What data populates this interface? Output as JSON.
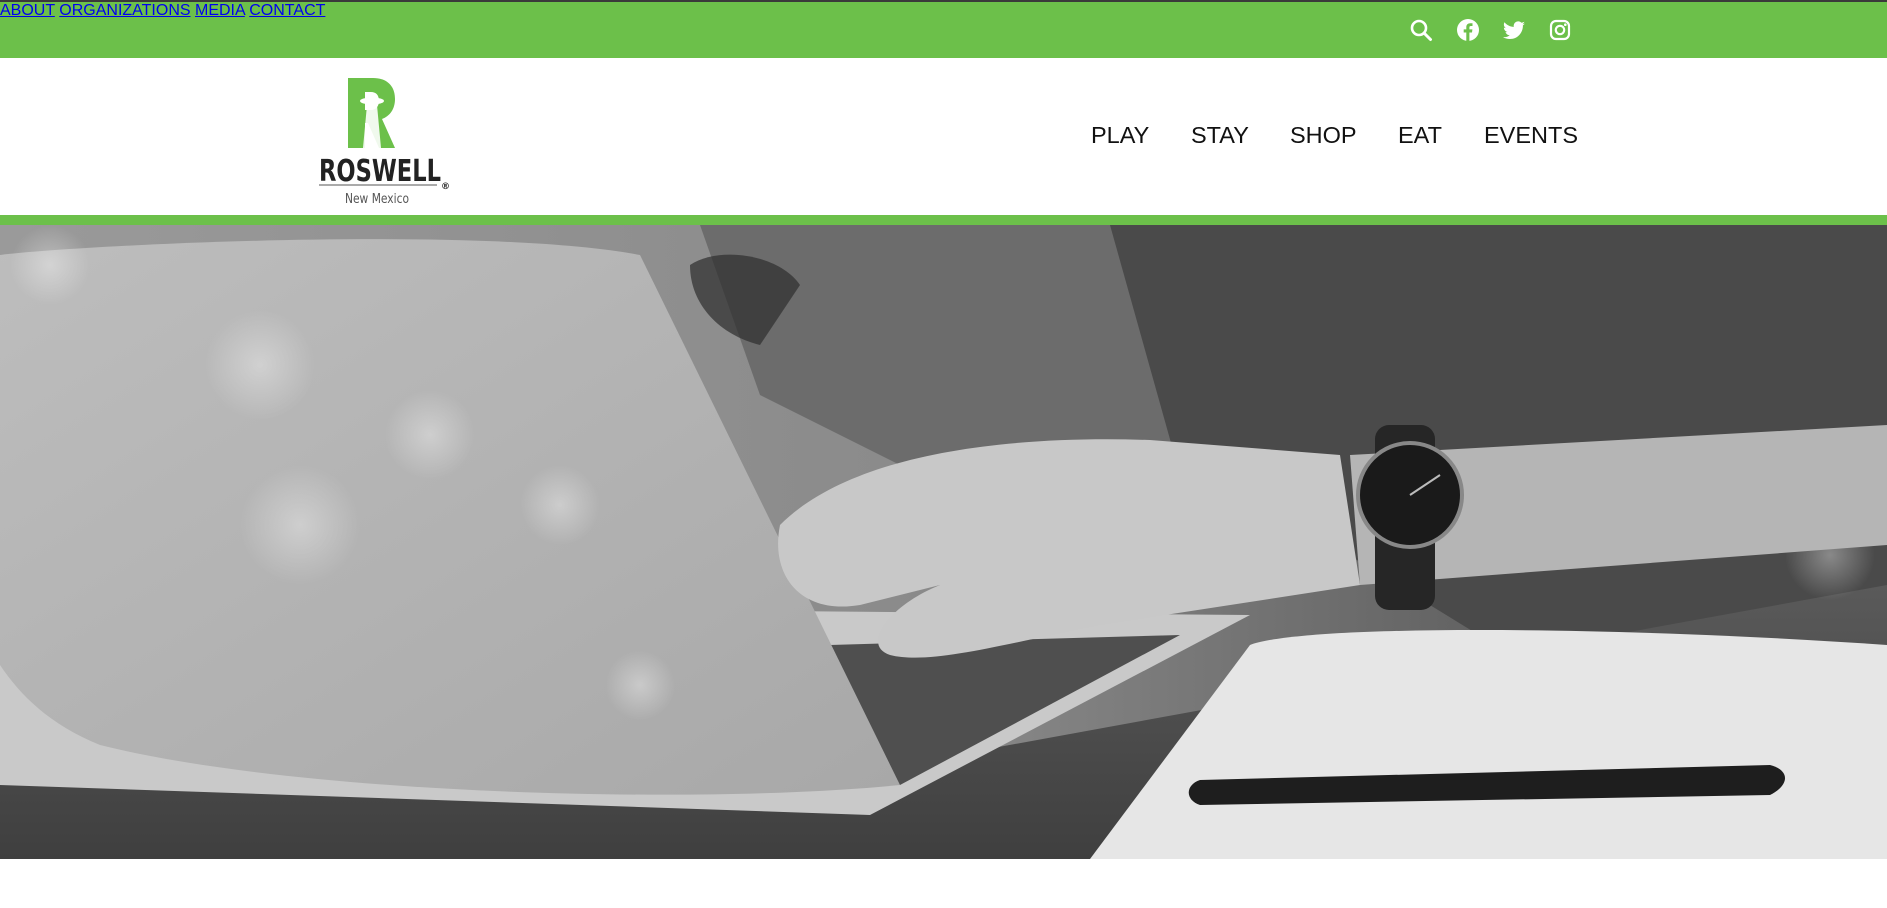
{
  "topbar": {
    "links": [
      {
        "label": "ABOUT"
      },
      {
        "label": "ORGANIZATIONS"
      },
      {
        "label": "MEDIA"
      },
      {
        "label": "CONTACT"
      }
    ],
    "icons": [
      "search-icon",
      "facebook-icon",
      "twitter-icon",
      "instagram-icon"
    ],
    "background": "#6cc04a"
  },
  "logo": {
    "wordmark": "ROSWELL",
    "subtitle": "New Mexico",
    "registered": "®",
    "brand_green": "#6cc04a"
  },
  "main_nav": [
    {
      "label": "PLAY"
    },
    {
      "label": "STAY"
    },
    {
      "label": "SHOP"
    },
    {
      "label": "EAT"
    },
    {
      "label": "EVENTS"
    }
  ],
  "hero": {
    "image": "grayscale-photo-hands-typing-on-laptop-with-wristwatch-pen-and-notebook"
  }
}
